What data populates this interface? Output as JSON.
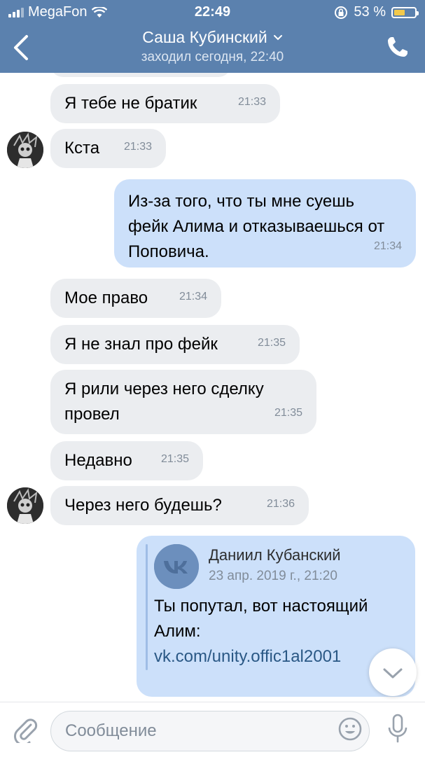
{
  "status_bar": {
    "carrier": "MegaFon",
    "time": "22:49",
    "battery": "53 %",
    "battery_level": 0.53
  },
  "header": {
    "title": "Саша Кубинский",
    "subtitle": "заходил сегодня, 22:40"
  },
  "messages": [
    {
      "text": "Я тебе не братик",
      "time": "21:33",
      "dir": "in"
    },
    {
      "text": "Кста",
      "time": "21:33",
      "dir": "in"
    },
    {
      "text": "Из-за того, что ты мне суешь фейк Алима и отказываешься от Поповича.",
      "time": "21:34",
      "dir": "out"
    },
    {
      "text": "Мое право",
      "time": "21:34",
      "dir": "in"
    },
    {
      "text": "Я не знал про фейк",
      "time": "21:35",
      "dir": "in"
    },
    {
      "text": "Я рили через него сделку провел",
      "time": "21:35",
      "dir": "in"
    },
    {
      "text": "Недавно",
      "time": "21:35",
      "dir": "in"
    },
    {
      "text": "Через него будешь?",
      "time": "21:36",
      "dir": "in"
    }
  ],
  "forwarded": {
    "author": "Даниил Кубанский",
    "date": "23 апр. 2019 г., 21:20",
    "text": "Ты попутал, вот настоящий Алим:",
    "link": "vk.com/unity.offic1al2001"
  },
  "composer": {
    "placeholder": "Сообщение"
  },
  "icons": [
    "back-arrow-icon",
    "chevron-down-icon",
    "phone-icon",
    "attach-icon",
    "emoji-icon",
    "mic-icon",
    "scroll-down-icon",
    "avatar",
    "vk-logo-icon"
  ]
}
